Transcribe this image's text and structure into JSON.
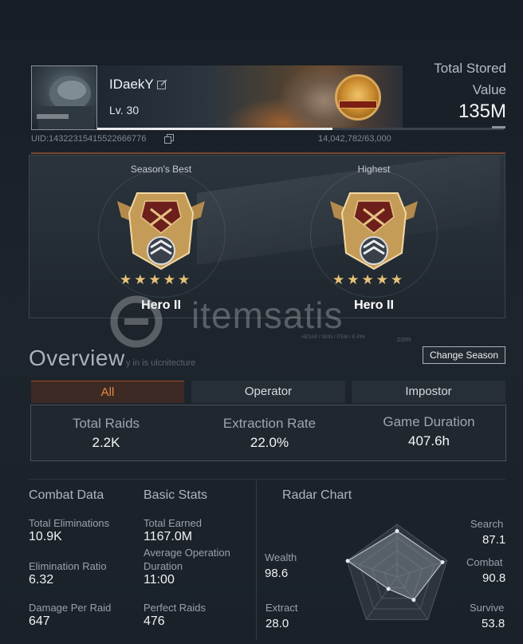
{
  "profile": {
    "username": "IDaekY",
    "level": "Lv. 30",
    "uid": "UID:1432231541552266​6776",
    "xp": "14,042,782/63,000",
    "xp_fraction": 0.77
  },
  "stored_value": {
    "label": "Total Stored Value",
    "value": "135M"
  },
  "ranks": [
    {
      "title": "Season's Best",
      "name": "Hero II",
      "stars": 5
    },
    {
      "title": "Highest",
      "name": "Hero II",
      "stars": 5
    }
  ],
  "overview": {
    "title": "Overview",
    "subtitle": "y in is ulcnitecture",
    "change_season_label": "Change Season"
  },
  "tabs": [
    {
      "label": "All",
      "active": true
    },
    {
      "label": "Operator",
      "active": false
    },
    {
      "label": "Impostor",
      "active": false
    }
  ],
  "summary": [
    {
      "label": "Total Raids",
      "value": "2.2K"
    },
    {
      "label": "Extraction Rate",
      "value": "22.0%"
    },
    {
      "label": "Game Duration",
      "value": "407.6h"
    }
  ],
  "combat": {
    "title": "Combat Data",
    "stats": [
      {
        "label": "Total Eliminations",
        "value": "10.9K"
      },
      {
        "label": "Elimination Ratio",
        "value": "6.32"
      },
      {
        "label": "Damage Per Raid",
        "value": "647"
      }
    ]
  },
  "basic": {
    "title": "Basic Stats",
    "stats": [
      {
        "label": "Total Earned",
        "value": "1167.0M"
      },
      {
        "label": "Average Operation Duration",
        "value": "11:00"
      },
      {
        "label": "Perfect Raids",
        "value": "476"
      }
    ]
  },
  "radar": {
    "title": "Radar Chart",
    "axes": [
      {
        "label": "Search",
        "value": "87.1"
      },
      {
        "label": "Combat",
        "value": "90.8"
      },
      {
        "label": "Survive",
        "value": "53.8"
      },
      {
        "label": "Extract",
        "value": "28.0"
      },
      {
        "label": "Wealth",
        "value": "98.6"
      }
    ]
  },
  "watermark": {
    "brand": "itemsatis",
    "tagline": "HESAP / SKIN / ITEM / E-PIN",
    "suffix": ".com"
  },
  "colors": {
    "accent": "#e8893f",
    "background": "#1b222a",
    "panel_border": "#4a525b"
  }
}
